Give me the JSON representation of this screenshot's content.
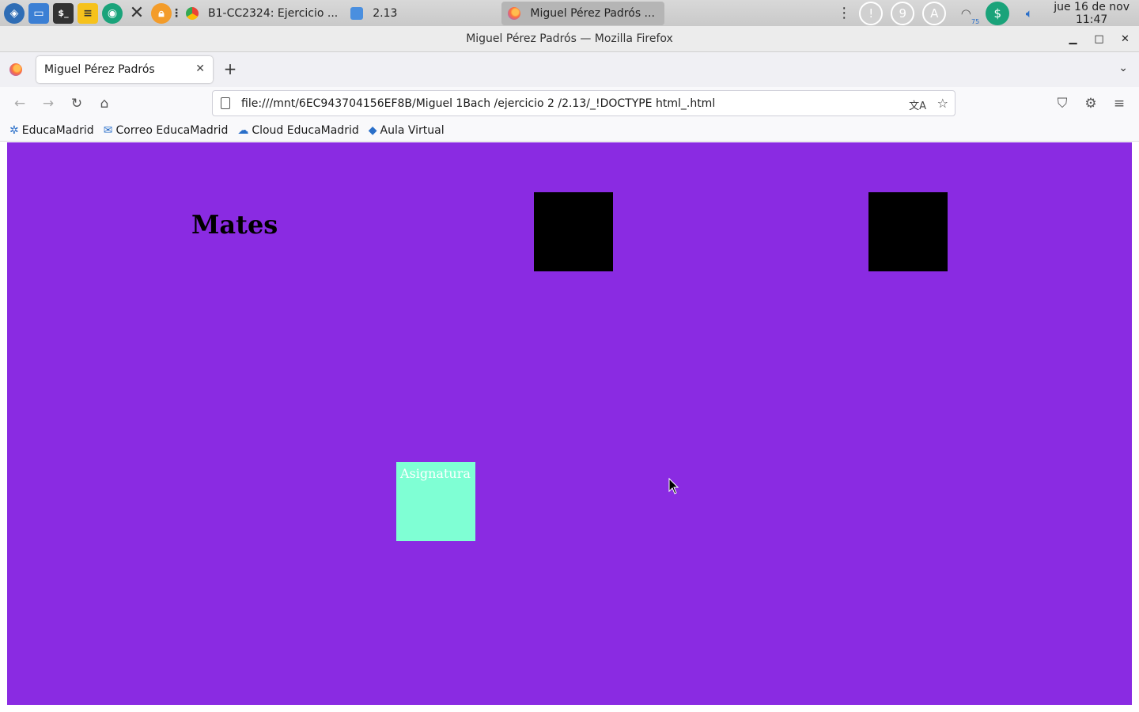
{
  "taskbar": {
    "tasks": [
      {
        "label": "B1-CC2324: Ejercicio ...",
        "icon": "chrome-icon"
      },
      {
        "label": "2.13",
        "icon": "folder-icon"
      },
      {
        "label": "Miguel Pérez Padrós ...",
        "icon": "firefox-icon",
        "active": true
      }
    ],
    "tray_badges": [
      "9",
      "A"
    ],
    "clock": {
      "date": "jue 16 de nov",
      "time": "11:47"
    },
    "wifi_badge": "75"
  },
  "window": {
    "title": "Miguel Pérez Padrós — Mozilla Firefox",
    "controls": {
      "minimize": "▁",
      "maximize": "□",
      "close": "✕"
    }
  },
  "tabs": [
    {
      "label": "Miguel Pérez Padrós",
      "close": "✕"
    }
  ],
  "tabstrip": {
    "new_tab": "+",
    "list_all": "⌄"
  },
  "navbar": {
    "url": "file:///mnt/6EC943704156EF8B/Miguel 1Bach /ejercicio 2 /2.13/_!DOCTYPE html_.html",
    "back": "←",
    "forward": "→",
    "reload": "↻",
    "home": "⌂",
    "translate": "文A",
    "bookmark_star": "☆",
    "pocket": "⛉",
    "extensions": "⚙",
    "menu": "≡"
  },
  "bookmarks": [
    {
      "label": "EducaMadrid",
      "icon": "educamadrid-icon"
    },
    {
      "label": "Correo EducaMadrid",
      "icon": "mail-icon"
    },
    {
      "label": "Cloud EducaMadrid",
      "icon": "cloud-icon"
    },
    {
      "label": "Aula Virtual",
      "icon": "graduation-cap-icon"
    }
  ],
  "page": {
    "background": "#8a2be2",
    "heading": "Mates",
    "subject_label": "Asignatura",
    "subject_box_color": "#7fffd4",
    "square_color": "#000000"
  }
}
